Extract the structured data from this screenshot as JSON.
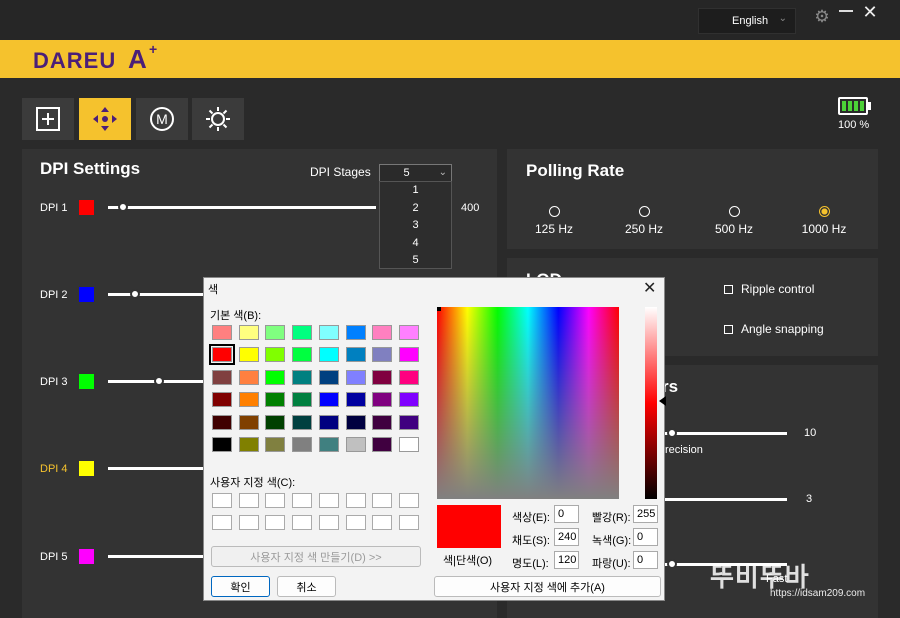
{
  "window": {
    "language": "English"
  },
  "brand": {
    "logo_text": "DAREU",
    "logo_mark": "A",
    "logo_plus": "+"
  },
  "tabs": [
    {
      "name": "add",
      "icon": "plus-square-icon"
    },
    {
      "name": "move",
      "icon": "dpad-icon",
      "active": true
    },
    {
      "name": "macro",
      "icon": "m-circle-icon",
      "glyph": "M"
    },
    {
      "name": "lighting",
      "icon": "sun-icon"
    }
  ],
  "battery": {
    "percent_label": "100 %",
    "level": 1.0
  },
  "dpi": {
    "title": "DPI Settings",
    "stages_label": "DPI Stages",
    "stages_value": "5",
    "stage_options": [
      "1",
      "2",
      "3",
      "4",
      "5"
    ],
    "max_value_label": "400",
    "rows": [
      {
        "label": "DPI 1",
        "color": "#ff0000",
        "level": 0.05
      },
      {
        "label": "DPI 2",
        "color": "#0000ff",
        "level": 0.09
      },
      {
        "label": "DPI 3",
        "color": "#00ff00",
        "level": 0.17
      },
      {
        "label": "DPI 4",
        "color": "#ffff00",
        "level": 0.0,
        "active": true
      },
      {
        "label": "DPI 5",
        "color": "#ff00ff",
        "level": 0.0
      }
    ]
  },
  "polling": {
    "title": "Polling Rate",
    "options": [
      {
        "label": "125 Hz",
        "checked": false
      },
      {
        "label": "250 Hz",
        "checked": false
      },
      {
        "label": "500 Hz",
        "checked": false
      },
      {
        "label": "1000 Hz",
        "checked": true
      }
    ]
  },
  "lod_panel": {
    "title_fragment": "LOD",
    "ripple_label": "Ripple control",
    "angle_label": "Angle snapping"
  },
  "sensor_panel": {
    "title_fragment": "rs",
    "value_a": "10",
    "precision_fragment": "recision",
    "value_b": "3",
    "fast_label": "Fast"
  },
  "color_dialog": {
    "title": "색",
    "basic_colors_label": "기본 색(B):",
    "basic_colors": [
      "#ff8080",
      "#ffff80",
      "#80ff80",
      "#00ff80",
      "#80ffff",
      "#0080ff",
      "#ff80c0",
      "#ff80ff",
      "#ff0000",
      "#ffff00",
      "#80ff00",
      "#00ff40",
      "#00ffff",
      "#0080c0",
      "#8080c0",
      "#ff00ff",
      "#804040",
      "#ff8040",
      "#00ff00",
      "#008080",
      "#004080",
      "#8080ff",
      "#800040",
      "#ff0080",
      "#800000",
      "#ff8000",
      "#008000",
      "#008040",
      "#0000ff",
      "#0000a0",
      "#800080",
      "#8000ff",
      "#400000",
      "#804000",
      "#004000",
      "#004040",
      "#000080",
      "#000040",
      "#400040",
      "#400080",
      "#000000",
      "#808000",
      "#808040",
      "#808080",
      "#408080",
      "#c0c0c0",
      "#400040",
      "#ffffff"
    ],
    "selected_index": 8,
    "custom_colors_label": "사용자 지정 색(C):",
    "define_custom_button": "사용자 지정 색 만들기(D) >>",
    "ok_button": "확인",
    "cancel_button": "취소",
    "solid_label": "색|단색(O)",
    "add_custom_button": "사용자 지정 색에 추가(A)",
    "preview_color": "#ff0000",
    "hue_label": "색상(E):",
    "hue_value": "0",
    "sat_label": "채도(S):",
    "sat_value": "240",
    "lum_label": "명도(L):",
    "lum_value": "120",
    "red_label": "빨강(R):",
    "red_value": "255",
    "green_label": "녹색(G):",
    "green_value": "0",
    "blue_label": "파랑(U):",
    "blue_value": "0"
  },
  "watermark": {
    "text": "뚜비뚜바",
    "url": "https://idsam209.com"
  }
}
